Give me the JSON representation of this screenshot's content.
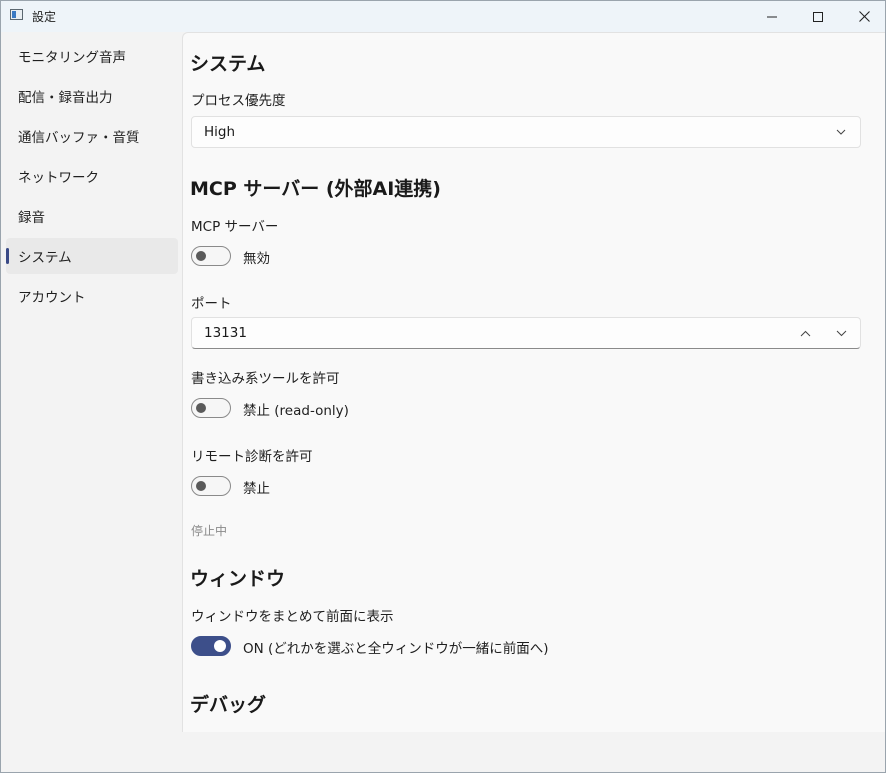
{
  "window": {
    "title": "設定",
    "controls": [
      "minimize-icon",
      "maximize-icon",
      "close-icon"
    ]
  },
  "sidebar": {
    "items": [
      {
        "label": "モニタリング音声",
        "selected": false
      },
      {
        "label": "配信・録音出力",
        "selected": false
      },
      {
        "label": "通信バッファ・音質",
        "selected": false
      },
      {
        "label": "ネットワーク",
        "selected": false
      },
      {
        "label": "録音",
        "selected": false
      },
      {
        "label": "システム",
        "selected": true
      },
      {
        "label": "アカウント",
        "selected": false
      }
    ]
  },
  "content": {
    "system": {
      "title": "システム",
      "priority_label": "プロセス優先度",
      "priority_value": "High"
    },
    "mcp": {
      "title": "MCP サーバー (外部AI連携)",
      "server_label": "MCP サーバー",
      "server_toggle_text": "無効",
      "server_toggle_on": false,
      "port_label": "ポート",
      "port_value": "13131",
      "write_label": "書き込み系ツールを許可",
      "write_toggle_text": "禁止 (read-only)",
      "write_toggle_on": false,
      "remote_label": "リモート診断を許可",
      "remote_toggle_text": "禁止",
      "remote_toggle_on": false,
      "status": "停止中"
    },
    "window_section": {
      "title": "ウィンドウ",
      "group_label": "ウィンドウをまとめて前面に表示",
      "group_toggle_text": "ON (どれかを選ぶと全ウィンドウが一緒に前面へ)",
      "group_toggle_on": true
    },
    "debug": {
      "title": "デバッグ"
    }
  },
  "colors": {
    "accent": "#3d4f8a",
    "selected_indicator": "#3a4a86"
  }
}
